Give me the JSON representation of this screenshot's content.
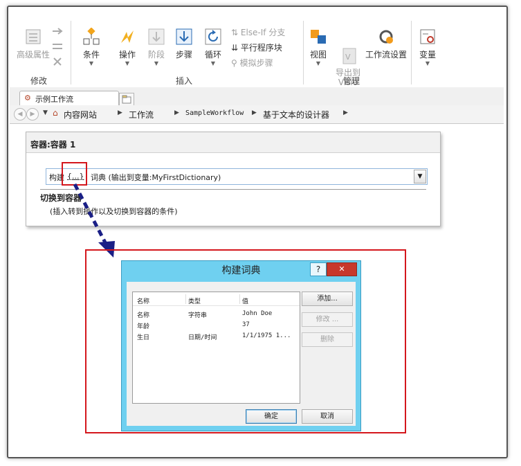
{
  "ribbon": {
    "groups": {
      "modify": {
        "label": "修改",
        "advanced_properties": "高级属性"
      },
      "insert": {
        "label": "插入",
        "condition": "条件",
        "action": "操作",
        "stage": "阶段",
        "step": "步骤",
        "loop": "循环",
        "else_if_branch": "Else-If 分支",
        "parallel_block": "平行程序块",
        "impersonation_step": "模拟步骤"
      },
      "manage": {
        "label": "管理",
        "view": "视图",
        "export_to_visio": "导出到\nVisio",
        "workflow_settings": "工作流设置"
      },
      "variables": {
        "label": "变量"
      }
    }
  },
  "tabs": {
    "workflow_tab": "示例工作流"
  },
  "breadcrumb": {
    "items": [
      "内容网站",
      "工作流",
      "SampleWorkflow",
      "基于文本的设计器"
    ]
  },
  "designer": {
    "stage_title": "容器:容器 1",
    "action_prefix": "构建",
    "action_link": "{...}",
    "action_rest": "词典 (输出到变量:MyFirstDictionary)",
    "transition_heading": "切换到容器",
    "transition_hint": "(插入转到操作以及切换到容器的条件)"
  },
  "dialog": {
    "title": "构建词典",
    "help_glyph": "?",
    "close_glyph": "✕",
    "columns": [
      "名称",
      "类型",
      "值"
    ],
    "rows": [
      {
        "name": "名称",
        "type": "字符串",
        "value": "John Doe"
      },
      {
        "name": "年龄",
        "type": "",
        "value": "37"
      },
      {
        "name": "生日",
        "type": "日期/时间",
        "value": "1/1/1975 1..."
      }
    ],
    "buttons": {
      "add": "添加...",
      "edit": "修改 ...",
      "delete": "删除",
      "ok": "确定",
      "cancel": "取消"
    }
  },
  "colors": {
    "annotation_red": "#d4161c",
    "arrow_navy": "#1a1f86",
    "dialog_frame": "#6fd0f0",
    "close_red": "#c7372b"
  }
}
